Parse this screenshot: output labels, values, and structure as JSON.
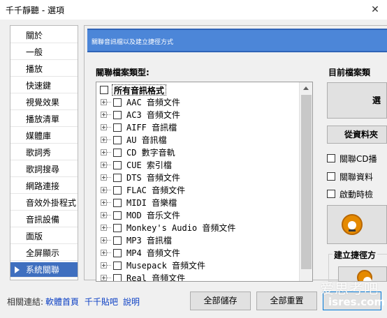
{
  "window": {
    "title": "千千靜聽 - 選項",
    "close_glyph": "✕"
  },
  "sidebar": {
    "items": [
      {
        "label": "關於"
      },
      {
        "label": "一般"
      },
      {
        "label": "播放"
      },
      {
        "label": "快速鍵"
      },
      {
        "label": "視覺效果"
      },
      {
        "label": "播放清單"
      },
      {
        "label": "媒體庫"
      },
      {
        "label": "歌詞秀"
      },
      {
        "label": "歌詞搜尋"
      },
      {
        "label": "網路連接"
      },
      {
        "label": "音效外掛程式"
      },
      {
        "label": "音訊設備"
      },
      {
        "label": "面版"
      },
      {
        "label": "全屏顯示"
      },
      {
        "label": "系統關聯"
      }
    ],
    "selected_index": 14,
    "selected_color": "#3f6fbf"
  },
  "panel": {
    "banner_text": "關聯音訊檔以及建立捷徑方式",
    "banner_color": "#4c86d8",
    "assoc_label": "關聯檔案類型:",
    "current_label": "目前檔案類",
    "tree": {
      "root": "所有音訊格式",
      "items": [
        "AAC 音頻文件",
        "AC3 音頻文件",
        "AIFF 音訊檔",
        "AU 音訊檔",
        "CD 數字音軌",
        "CUE 索引檔",
        "DTS 音頻文件",
        "FLAC 音頻文件",
        "MIDI 音樂檔",
        "MOD 音乐文件",
        "Monkey's Audio 音頻文件",
        "MP3 音訊檔",
        "MP4 音頻文件",
        "Musepack 音頻文件",
        "Real 音頻文件"
      ]
    },
    "right": {
      "big_button": "選",
      "from_data_button": "從資料夾",
      "check_cd": "關聯CD播",
      "check_data": "關聯資料",
      "check_startup": "啟動時檢",
      "shortcut_group": "建立捷徑方"
    }
  },
  "footer": {
    "links_label": "相關連結:",
    "links": [
      "軟體首頁",
      "千千貼吧",
      "說明"
    ],
    "save_all": "全部儲存",
    "reset_all": "全部重置"
  },
  "watermark": {
    "line1": "爱思考吧",
    "line2": "isres.com"
  }
}
